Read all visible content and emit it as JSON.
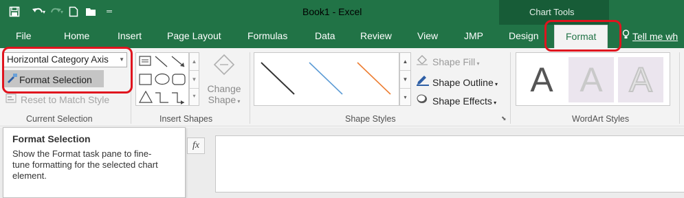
{
  "window": {
    "title": "Book1 - Excel",
    "contextual_title": "Chart Tools"
  },
  "qat": {
    "icons": [
      "save-icon",
      "undo-icon",
      "redo-icon",
      "new-document-icon",
      "open-folder-icon",
      "customize-qat-icon"
    ]
  },
  "tabs": [
    {
      "label": "File"
    },
    {
      "label": "Home"
    },
    {
      "label": "Insert"
    },
    {
      "label": "Page Layout"
    },
    {
      "label": "Formulas"
    },
    {
      "label": "Data"
    },
    {
      "label": "Review"
    },
    {
      "label": "View"
    },
    {
      "label": "JMP"
    },
    {
      "label": "Design"
    },
    {
      "label": "Format",
      "active": true
    }
  ],
  "tell_me": "Tell me wh",
  "current_selection": {
    "dropdown_value": "Horizontal Category Axis",
    "format_selection_label": "Format Selection",
    "reset_label": "Reset to Match Style",
    "group_label": "Current Selection"
  },
  "insert_shapes": {
    "change_shape_label_1": "Change",
    "change_shape_label_2": "Shape",
    "group_label": "Insert Shapes"
  },
  "shape_styles": {
    "line_colors": [
      "#333333",
      "#5b9bd5",
      "#ed7d31"
    ],
    "shape_fill_label": "Shape Fill",
    "shape_outline_label": "Shape Outline",
    "shape_effects_label": "Shape Effects",
    "group_label": "Shape Styles"
  },
  "wordart": {
    "sample_letter": "A",
    "group_label": "WordArt Styles"
  },
  "formula_bar": {
    "fx_label": "fx"
  },
  "tooltip": {
    "title": "Format Selection",
    "body": "Show the Format task pane to fine-tune formatting for the selected chart element."
  },
  "colors": {
    "excel_green": "#217346",
    "highlight_red": "#e0141e"
  }
}
